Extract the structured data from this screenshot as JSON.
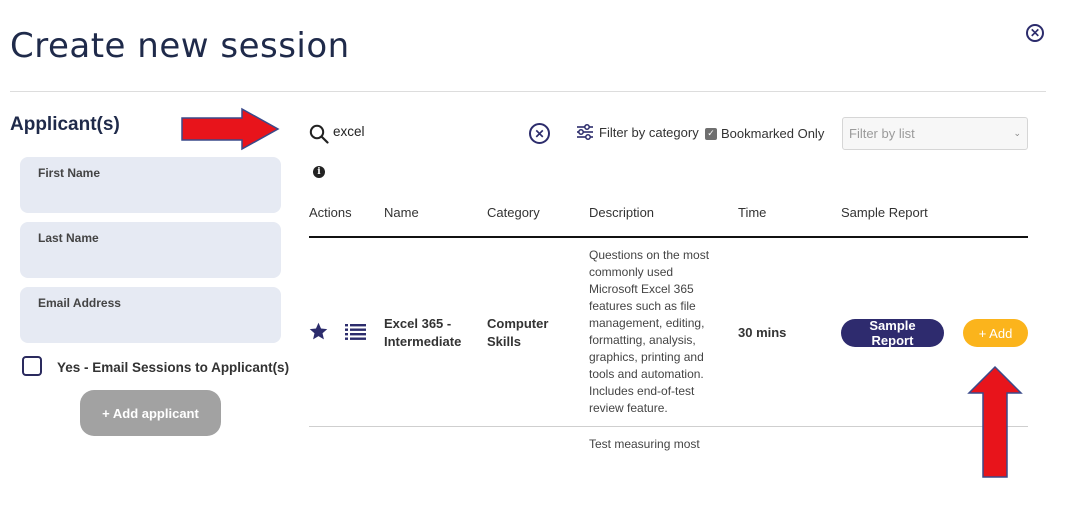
{
  "header": {
    "title": "Create new session"
  },
  "applicants": {
    "heading": "Applicant(s)",
    "fields": [
      {
        "label": "First Name"
      },
      {
        "label": "Last Name"
      },
      {
        "label": "Email Address"
      }
    ],
    "email_sessions_label": "Yes - Email Sessions to Applicant(s)",
    "email_sessions_checked": false,
    "add_button": "+ Add applicant"
  },
  "search": {
    "value": "excel",
    "filter_category_label": "Filter by category",
    "bookmarked_label": "Bookmarked Only",
    "bookmarked_checked": true,
    "filter_list_placeholder": "Filter by list"
  },
  "table": {
    "columns": [
      "Actions",
      "Name",
      "Category",
      "Description",
      "Time",
      "Sample Report"
    ],
    "rows": [
      {
        "name": "Excel 365 - Intermediate",
        "category": "Computer Skills",
        "description": "Questions on the most commonly used Microsoft Excel 365 features such as file management, editing, formatting, analysis, graphics, printing and tools and automation. Includes end-of-test review feature.",
        "time": "30 mins",
        "sample_report_label": "Sample Report",
        "add_label": "+ Add"
      },
      {
        "description": "Test measuring most"
      }
    ]
  },
  "icons": {
    "close": "close-circle-icon",
    "search": "search-icon",
    "clear": "clear-circle-icon",
    "filter": "sliders-icon",
    "info": "info-icon",
    "bookmark": "star-icon",
    "list": "list-icon"
  },
  "colors": {
    "title": "#1f2a4a",
    "field_bg": "#e6eaf3",
    "primary_dark": "#2e2b6e",
    "add_orange": "#fbb41c",
    "add_applicant_grey": "#a2a2a2",
    "annotation_arrow": "#e8141b"
  }
}
